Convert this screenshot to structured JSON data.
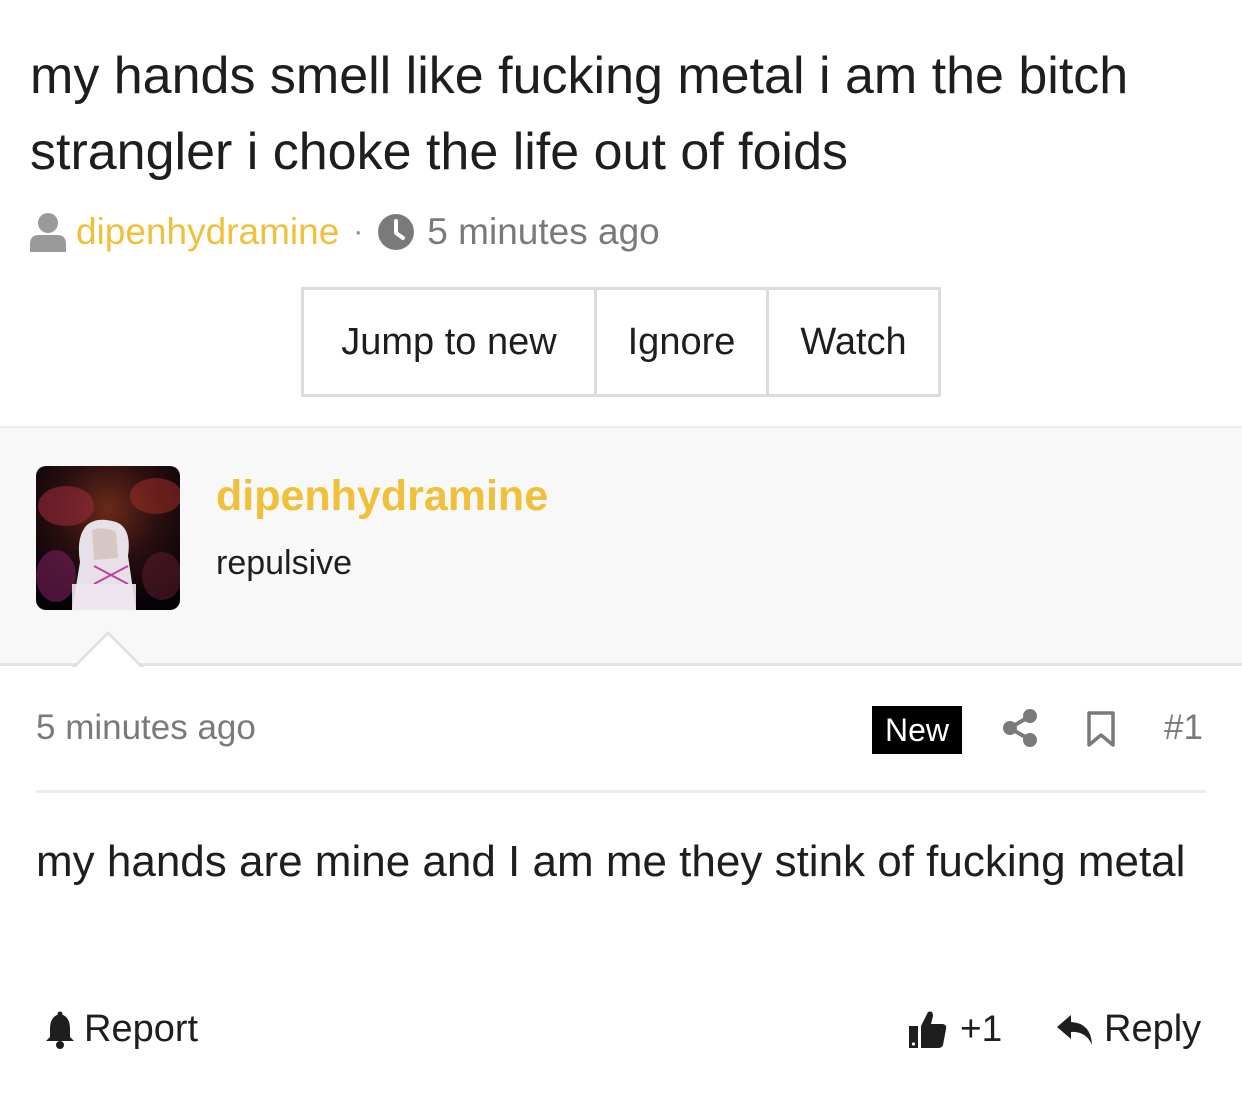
{
  "thread": {
    "title": "my hands smell like fucking metal i am the bitch strangler i choke the life out of foids",
    "author": "dipenhydramine",
    "separator": "·",
    "time": "5 minutes ago"
  },
  "actions": {
    "jump_to_new": "Jump to new",
    "ignore": "Ignore",
    "watch": "Watch"
  },
  "post": {
    "author": "dipenhydramine",
    "role": "repulsive",
    "time": "5 minutes ago",
    "new_badge": "New",
    "index": "#1",
    "body": "my hands are mine and I am me they stink of fucking metal",
    "report_label": "Report",
    "vote_label": "+1",
    "reply_label": "Reply"
  },
  "icons": {
    "user": "user-icon",
    "clock": "clock-icon",
    "share": "share-icon",
    "bookmark": "bookmark-icon",
    "bell": "bell-icon",
    "thumb": "thumbs-up-icon",
    "reply": "reply-icon"
  },
  "colors": {
    "accent": "#f0c03a",
    "muted": "#7a7a7a",
    "badge_bg": "#000000",
    "header_bg": "#f8f8f8"
  }
}
